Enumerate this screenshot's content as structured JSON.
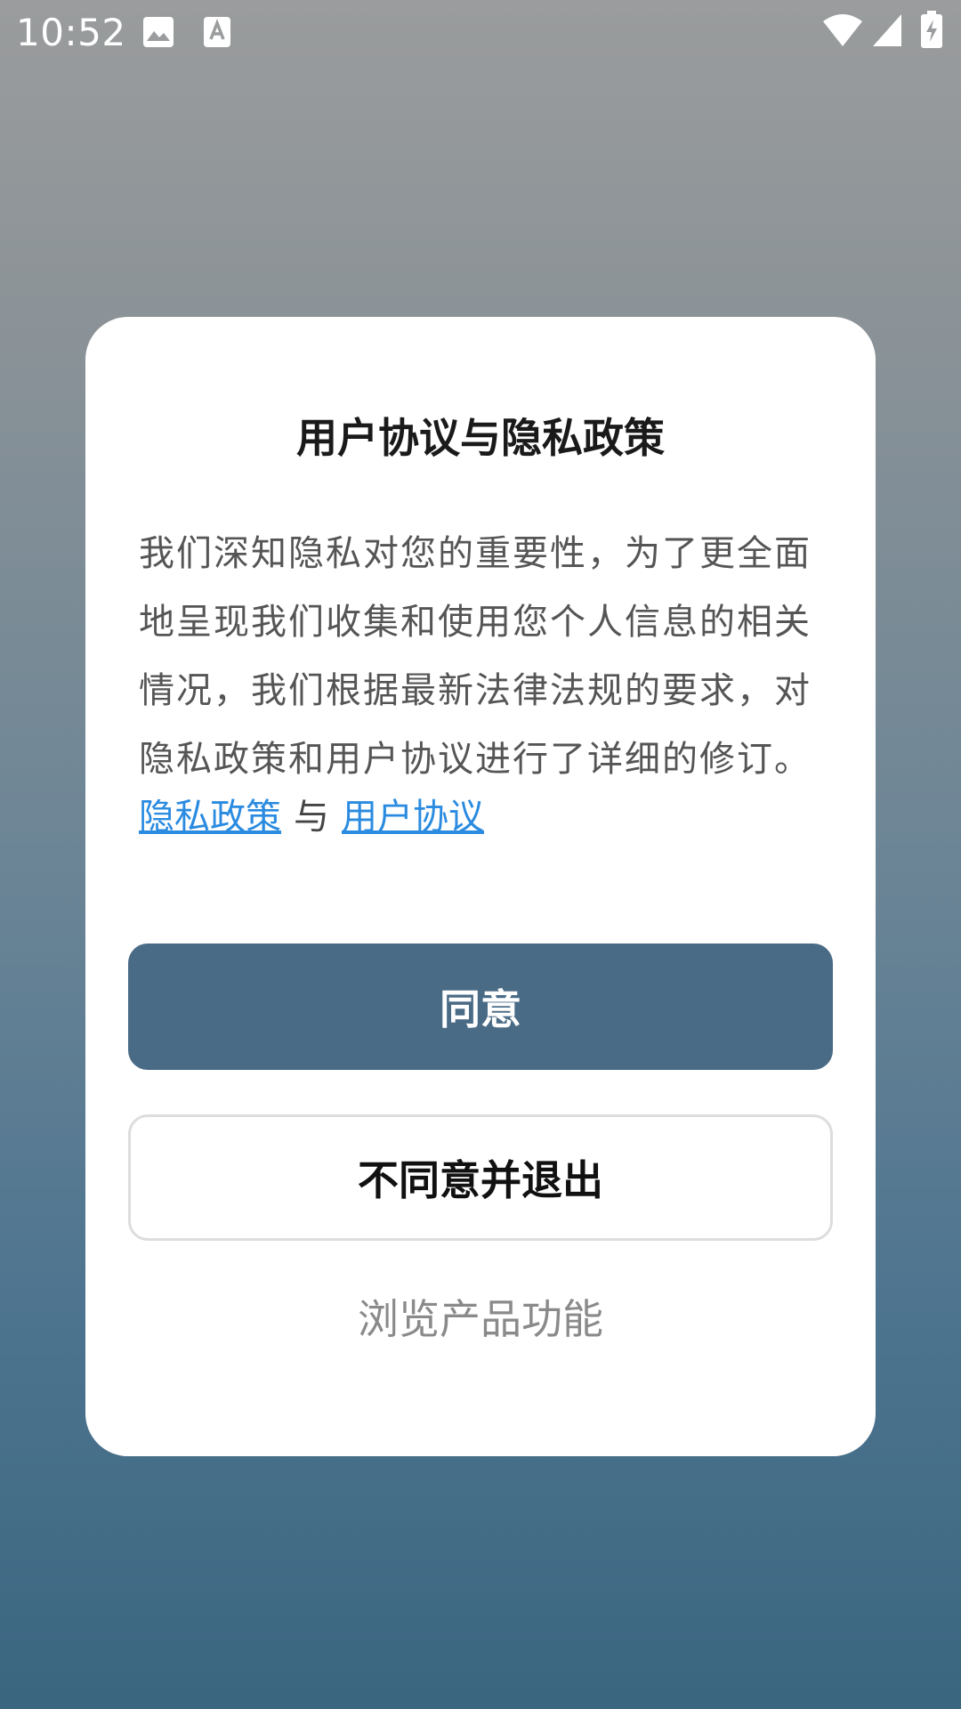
{
  "status_bar": {
    "time": "10:52",
    "icons": [
      "image-icon",
      "text-a-icon",
      "wifi-icon",
      "signal-icon",
      "battery-charging-icon"
    ]
  },
  "dialog": {
    "title": "用户协议与隐私政策",
    "body": "我们深知隐私对您的重要性，为了更全面地呈现我们收集和使用您个人信息的相关情况，我们根据最新法律法规的要求，对隐私政策和用户协议进行了详细的修订。",
    "privacy_link": "隐私政策",
    "separator": "与",
    "terms_link": "用户协议",
    "agree_button": "同意",
    "disagree_button": "不同意并退出",
    "browse_link": "浏览产品功能"
  },
  "colors": {
    "primary": "#4a6b86",
    "link": "#2a8be0",
    "muted": "#8a8a8a"
  }
}
